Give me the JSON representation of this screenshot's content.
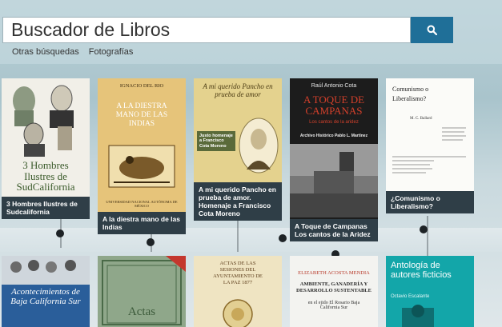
{
  "header": {
    "search_value": "Buscador de Libros",
    "search_icon": "search-icon",
    "links": [
      "Otras búsquedas",
      "Fotografías"
    ]
  },
  "colors": {
    "accent": "#1f6f98",
    "caption_bg": "#2f3e47"
  },
  "books_row1": [
    {
      "caption": "3 Hombres Ilustres de Sudcalifornia",
      "cover_title": "3 Hombres Ilustres de SudCalifornia",
      "cover_sub": ""
    },
    {
      "caption": "A la diestra mano de las Indias",
      "cover_author": "IGNACIO DEL RIO",
      "cover_title": "A LA DIESTRA MANO DE LAS INDIAS",
      "cover_sub": "UNIVERSIDAD NACIONAL AUTÓNOMA DE MÉXICO"
    },
    {
      "caption": "A mi querido Pancho en prueba de amor. Homenaje a Francisco Cota Moreno",
      "cover_title": "A mi querido Pancho en prueba de amor",
      "cover_sub": "Justo homenaje a Francisco Cota Moreno"
    },
    {
      "caption": "A Toque de Campanas Los cantos de la Aridez",
      "cover_author": "Raúl Antonio Cota",
      "cover_title": "A TOQUE DE CAMPANAS",
      "cover_sub": "Los cantos de la aridez",
      "cover_note": "Archivo Histórico Pablo L. Martínez"
    },
    {
      "caption": "¿Comunismo o Liberalismo?",
      "cover_title": "Comunismo o Liberalismo?",
      "cover_sub": "M. C. Ballard"
    }
  ],
  "books_row2": [
    {
      "cover_title": "Acontecimientos de Baja California Sur"
    },
    {
      "cover_title": "Actas"
    },
    {
      "cover_title": "ACTAS DE LAS SESIONES DEL AYUNTAMIENTO DE LA PAZ 1877"
    },
    {
      "cover_author": "ELIZABETH ACOSTA MENDIA",
      "cover_title": "AMBIENTE, GANADERÍA Y DESARROLLO SUSTENTABLE",
      "cover_sub": "en el ejido El Rosario Baja California Sur"
    },
    {
      "cover_title": "Antología de autores ficticios",
      "cover_sub": "Octavio Escalante"
    }
  ]
}
